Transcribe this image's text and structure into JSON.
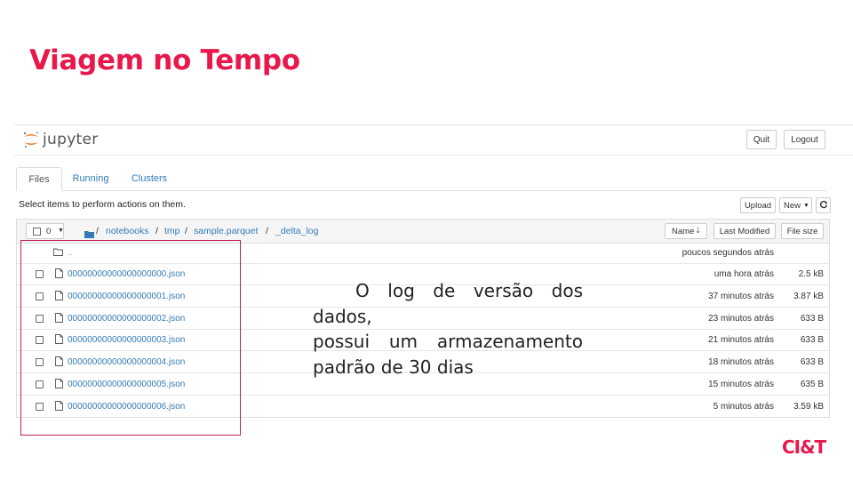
{
  "slide": {
    "title": "Viagem no Tempo",
    "note_lines": [
      "O log de versão dos dados,",
      "possui um armazenamento",
      "padrão de 30 dias"
    ],
    "brand": "CI&T",
    "accent_color": "#e8194a"
  },
  "jupyter": {
    "wordmark": "jupyter",
    "quit_label": "Quit",
    "logout_label": "Logout",
    "tabs": [
      {
        "label": "Files",
        "active": true
      },
      {
        "label": "Running",
        "active": false
      },
      {
        "label": "Clusters",
        "active": false
      }
    ],
    "actions_text": "Select items to perform actions on them.",
    "upload_label": "Upload",
    "new_label": "New",
    "selected_count": "0",
    "breadcrumb": [
      "notebooks",
      "tmp",
      "sample.parquet",
      "_delta_log"
    ],
    "sort_name_label": "Name",
    "last_modified_label": "Last Modified",
    "file_size_label": "File size",
    "parent_row": {
      "name": "..",
      "modified": "poucos segundos atrás"
    },
    "files": [
      {
        "name": "00000000000000000000.json",
        "modified": "uma hora atrás",
        "size": "2.5 kB"
      },
      {
        "name": "00000000000000000001.json",
        "modified": "37 minutos atrás",
        "size": "3.87 kB"
      },
      {
        "name": "00000000000000000002.json",
        "modified": "23 minutos atrás",
        "size": "633 B"
      },
      {
        "name": "00000000000000000003.json",
        "modified": "21 minutos atrás",
        "size": "633 B"
      },
      {
        "name": "00000000000000000004.json",
        "modified": "18 minutos atrás",
        "size": "633 B"
      },
      {
        "name": "00000000000000000005.json",
        "modified": "15 minutos atrás",
        "size": "635 B"
      },
      {
        "name": "00000000000000000006.json",
        "modified": "5 minutos atrás",
        "size": "3.59 kB"
      }
    ]
  }
}
